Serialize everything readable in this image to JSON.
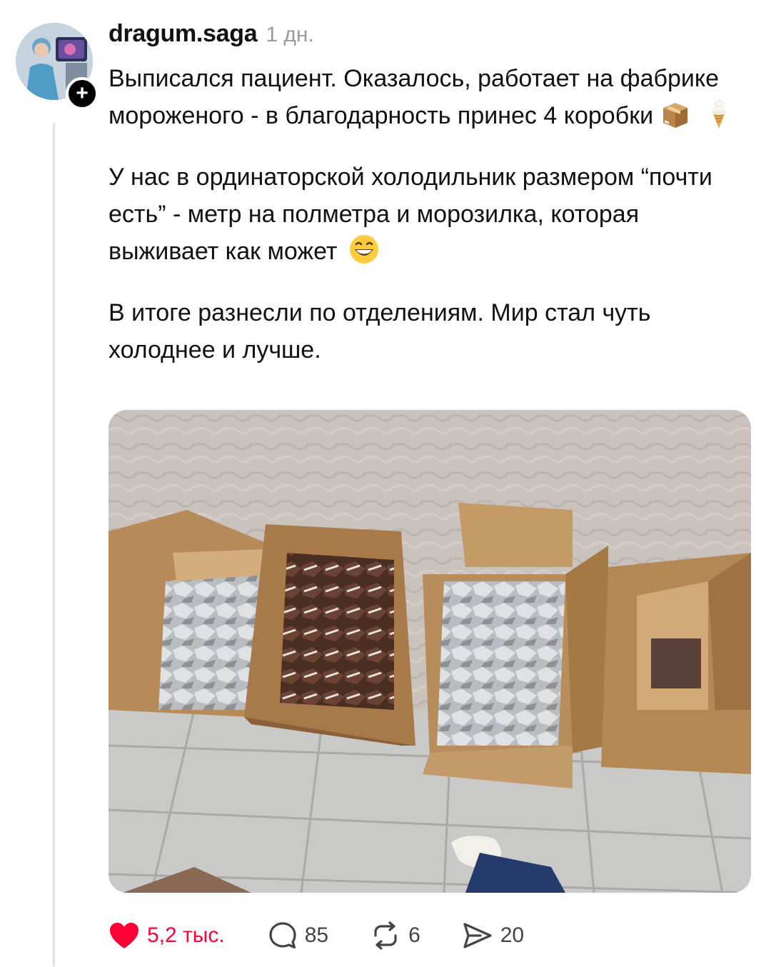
{
  "post": {
    "username": "dragum.saga",
    "time": "1 дн.",
    "paragraphs": [
      "Выписался пациент. Оказалось, работает на фабрике мороженого - в благодарность принес 4 коробки",
      "У нас в ординаторской холодильник размером “почти есть” - метр на полметра и морозилка, которая выживает как может",
      "В итоге разнесли по отделениям. Мир стал чуть холоднее и лучше."
    ],
    "emoji_after_paragraph_1": [
      "package-icon",
      "soft-ice-cream-icon"
    ],
    "emoji_after_paragraph_2": [
      "grinning-face-icon"
    ]
  },
  "actions": {
    "likes": "5,2 тыс.",
    "replies": "85",
    "reposts": "6",
    "shares": "20",
    "liked": true
  },
  "colors": {
    "like": "#ff0034",
    "text": "#111111",
    "muted": "#9a9a9a",
    "thread_line": "#e2e2e2"
  }
}
